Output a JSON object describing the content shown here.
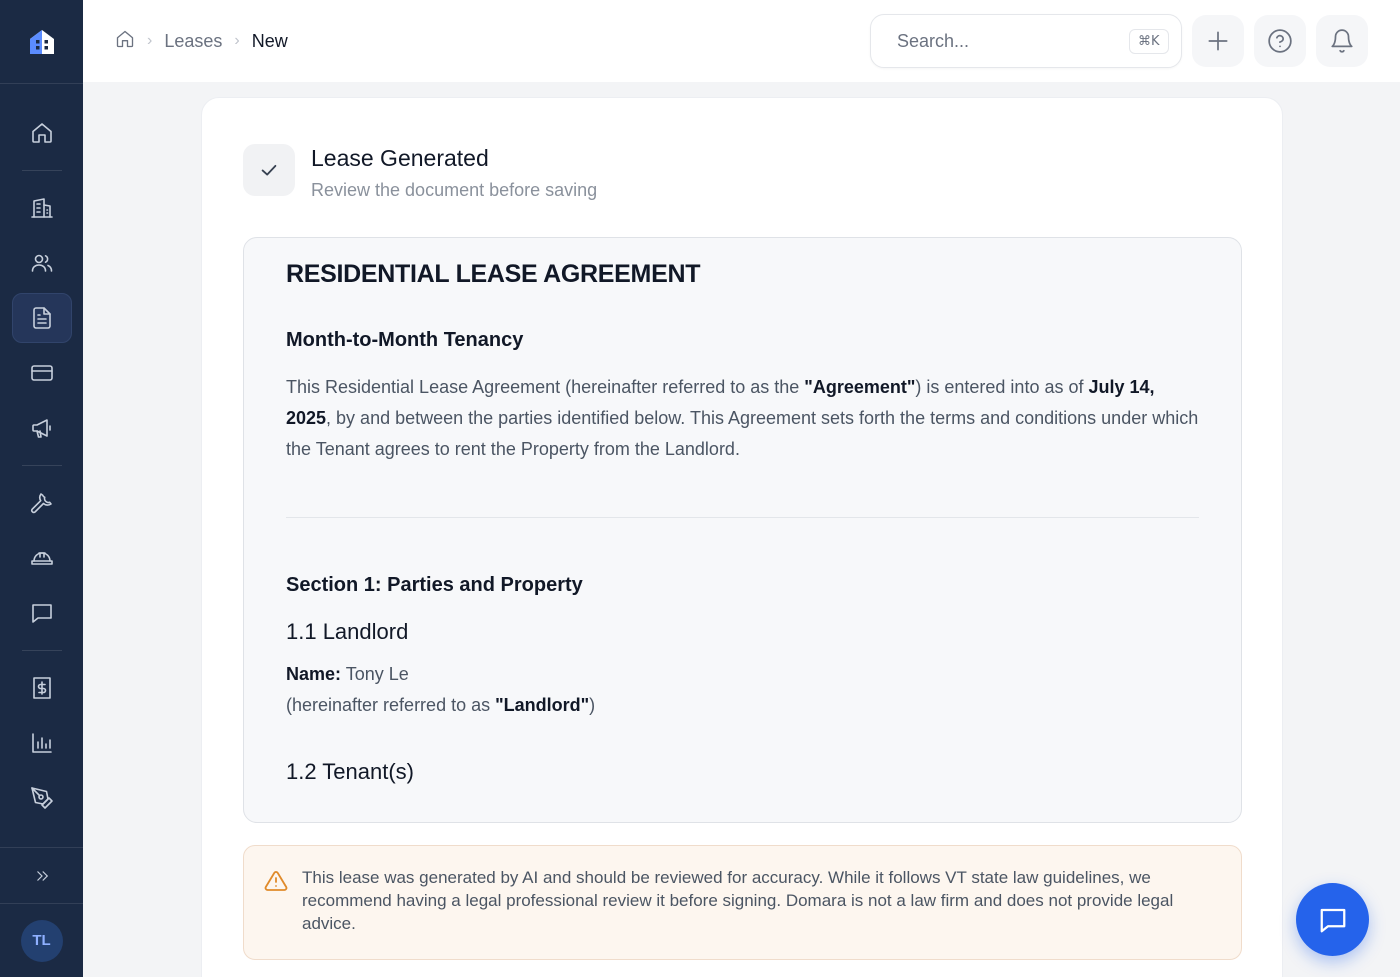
{
  "app": {
    "brand_icon": "house-logo-icon",
    "accent_color": "#2563eb",
    "sidebar_color": "#1b2a44"
  },
  "sidebar": {
    "items": [
      {
        "name": "dashboard",
        "icon": "home-icon"
      },
      {
        "name": "properties",
        "icon": "building-icon"
      },
      {
        "name": "tenants",
        "icon": "users-icon"
      },
      {
        "name": "leases",
        "icon": "document-icon",
        "active": true
      },
      {
        "name": "payments",
        "icon": "credit-card-icon"
      },
      {
        "name": "announcements",
        "icon": "megaphone-icon"
      },
      {
        "name": "maintenance",
        "icon": "wrench-icon"
      },
      {
        "name": "vendors",
        "icon": "hard-hat-icon"
      },
      {
        "name": "messages",
        "icon": "message-icon"
      },
      {
        "name": "accounting",
        "icon": "invoice-dollar-icon"
      },
      {
        "name": "reports",
        "icon": "bar-chart-icon"
      },
      {
        "name": "signatures",
        "icon": "pen-tool-icon"
      }
    ],
    "expand_icon": "chevrons-right-icon",
    "user_initials": "TL"
  },
  "header": {
    "breadcrumb": {
      "home_icon": "home-icon",
      "items": [
        "Leases",
        "New"
      ]
    },
    "search": {
      "placeholder": "Search...",
      "shortcut": "⌘K"
    },
    "actions": [
      "plus-icon",
      "help-circle-icon",
      "bell-icon"
    ]
  },
  "status": {
    "title": "Lease Generated",
    "subtitle": "Review the document before saving"
  },
  "document": {
    "title": "RESIDENTIAL LEASE AGREEMENT",
    "subtitle": "Month-to-Month Tenancy",
    "intro": {
      "part1": "This Residential Lease Agreement (hereinafter referred to as the ",
      "bold1": "\"Agreement\"",
      "part2": ") is entered into as of ",
      "bold2": "July 14, 2025",
      "part3": ", by and between the parties identified below. This Agreement sets forth the terms and conditions under which the Tenant agrees to rent the Property from the Landlord."
    },
    "section1_title": "Section 1: Parties and Property",
    "landlord_heading": "1.1 Landlord",
    "landlord_name_label": "Name:",
    "landlord_name": "Tony Le",
    "landlord_ref_prefix": "(hereinafter referred to as ",
    "landlord_ref_bold": "\"Landlord\"",
    "landlord_ref_suffix": ")",
    "tenant_heading": "1.2 Tenant(s)"
  },
  "disclaimer": {
    "icon": "warning-triangle-icon",
    "text": "This lease was generated by AI and should be reviewed for accuracy. While it follows VT state law guidelines, we recommend having a legal professional review it before signing. Domara is not a law firm and does not provide legal advice."
  },
  "chat": {
    "icon": "chat-bubble-icon"
  }
}
